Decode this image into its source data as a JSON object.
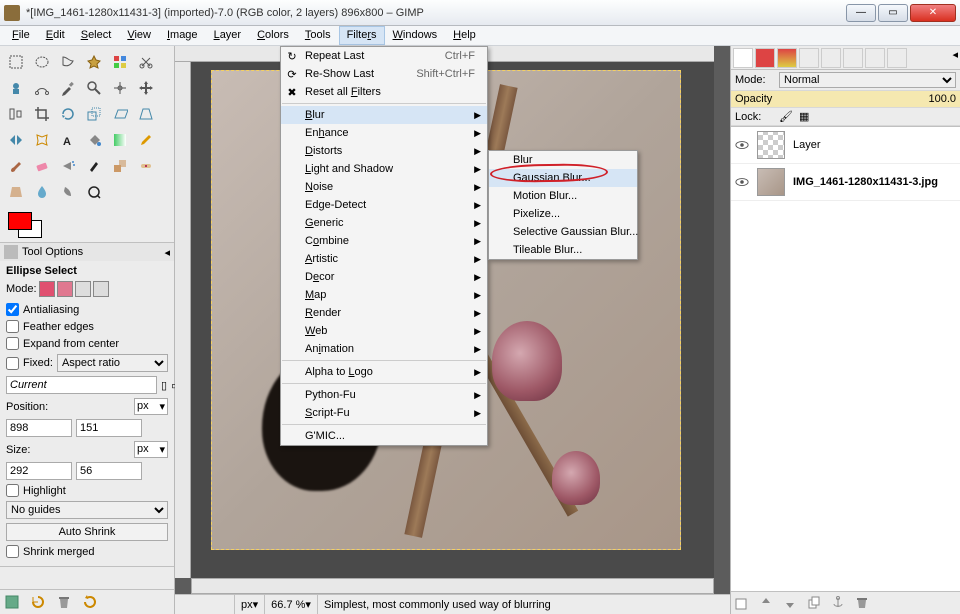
{
  "window": {
    "title": "*[IMG_1461-1280x11431-3] (imported)-7.0 (RGB color, 2 layers) 896x800 – GIMP",
    "min": "—",
    "max": "▭",
    "close": "✕"
  },
  "menubar": [
    "File",
    "Edit",
    "Select",
    "View",
    "Image",
    "Layer",
    "Colors",
    "Tools",
    "Filters",
    "Windows",
    "Help"
  ],
  "filters_menu": {
    "repeat": "Repeat Last",
    "repeat_sc": "Ctrl+F",
    "reshow": "Re-Show Last",
    "reshow_sc": "Shift+Ctrl+F",
    "reset": "Reset all Filters",
    "groups": [
      "Blur",
      "Enhance",
      "Distorts",
      "Light and Shadow",
      "Noise",
      "Edge-Detect",
      "Generic",
      "Combine",
      "Artistic",
      "Decor",
      "Map",
      "Render",
      "Web",
      "Animation"
    ],
    "extra": [
      "Alpha to Logo",
      "Python-Fu",
      "Script-Fu"
    ],
    "gmic": "G'MIC..."
  },
  "blur_menu": [
    "Blur",
    "Gaussian Blur...",
    "Motion Blur...",
    "Pixelize...",
    "Selective Gaussian Blur...",
    "Tileable Blur..."
  ],
  "tool_options": {
    "header": "Tool Options",
    "title": "Ellipse Select",
    "mode_label": "Mode:",
    "antialias": "Antialiasing",
    "feather": "Feather edges",
    "expand": "Expand from center",
    "fixed": "Fixed:",
    "fixed_val": "Aspect ratio",
    "current": "Current",
    "pos_label": "Position:",
    "pos_x": "898",
    "pos_y": "151",
    "size_label": "Size:",
    "size_w": "292",
    "size_h": "56",
    "px": "px",
    "highlight": "Highlight",
    "guides": "No guides",
    "autoshrink": "Auto Shrink",
    "shrinkmerged": "Shrink merged"
  },
  "status": {
    "px": "px",
    "zoom": "66.7 %",
    "hint": "Simplest, most commonly used way of blurring"
  },
  "rightpanel": {
    "mode_label": "Mode:",
    "mode_val": "Normal",
    "opacity_label": "Opacity",
    "opacity_val": "100.0",
    "lock_label": "Lock:",
    "layer1": "Layer",
    "layer2": "IMG_1461-1280x11431-3.jpg"
  }
}
